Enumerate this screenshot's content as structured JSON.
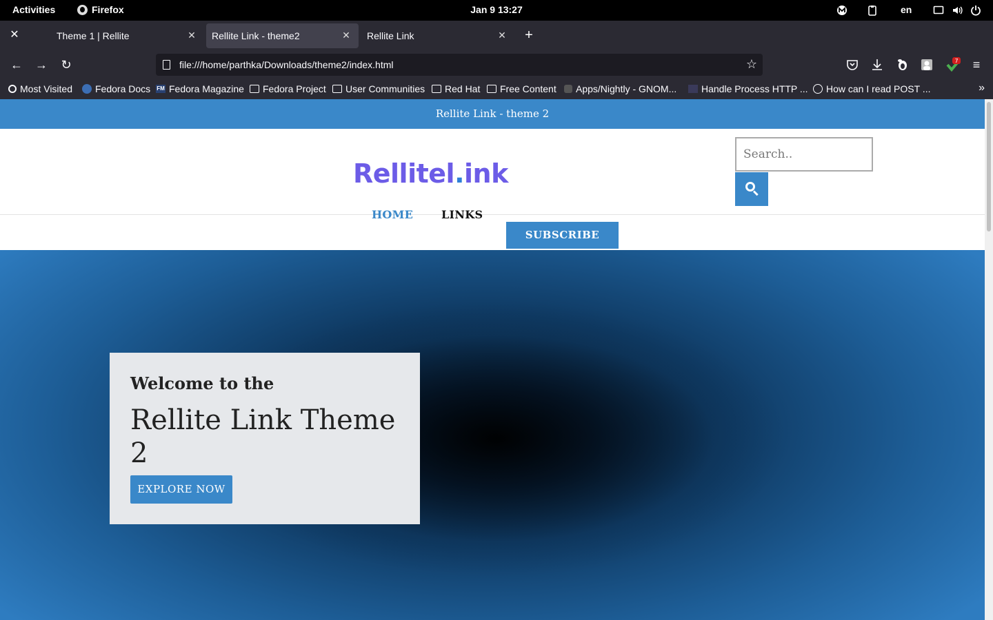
{
  "system_bar": {
    "activities": "Activities",
    "app_name": "Firefox",
    "clock": "Jan 9  13:27",
    "language": "en",
    "notification_count": "7"
  },
  "browser": {
    "tabs": [
      {
        "title": "Theme 1 | Rellite"
      },
      {
        "title": "Rellite Link - theme2"
      },
      {
        "title": "Rellite Link"
      }
    ],
    "active_tab_index": 1,
    "url": "file:///home/parthka/Downloads/theme2/index.html",
    "bookmarks": [
      {
        "label": "Most Visited",
        "icon": "gear-icon"
      },
      {
        "label": "Fedora Docs",
        "icon": "fedora-icon"
      },
      {
        "label": "Fedora Magazine",
        "icon": "fedora-magazine-icon"
      },
      {
        "label": "Fedora Project",
        "icon": "folder-icon"
      },
      {
        "label": "User Communities",
        "icon": "folder-icon"
      },
      {
        "label": "Red Hat",
        "icon": "folder-icon"
      },
      {
        "label": "Free Content",
        "icon": "folder-icon"
      },
      {
        "label": "Apps/Nightly - GNOM...",
        "icon": "gnome-icon"
      },
      {
        "label": "Handle Process HTTP ...",
        "icon": "page-icon"
      },
      {
        "label": "How can I read POST ...",
        "icon": "globe-icon"
      }
    ]
  },
  "site": {
    "announcement": "Rellite Link - theme 2",
    "logo_main": "Rellitel",
    "logo_dot": ".",
    "logo_tail": "ink",
    "search_placeholder": "Search..",
    "nav": {
      "home": "HOME",
      "links": "LINKS"
    },
    "subscribe": "SUBSCRIBE",
    "hero": {
      "pre_title": "Welcome to the",
      "title": "Rellite Link Theme 2",
      "cta": "EXPLORE NOW"
    }
  },
  "colors": {
    "accent": "#3a88c9",
    "logo_purple": "#6c5ce7",
    "card_bg": "#e6e8eb"
  }
}
